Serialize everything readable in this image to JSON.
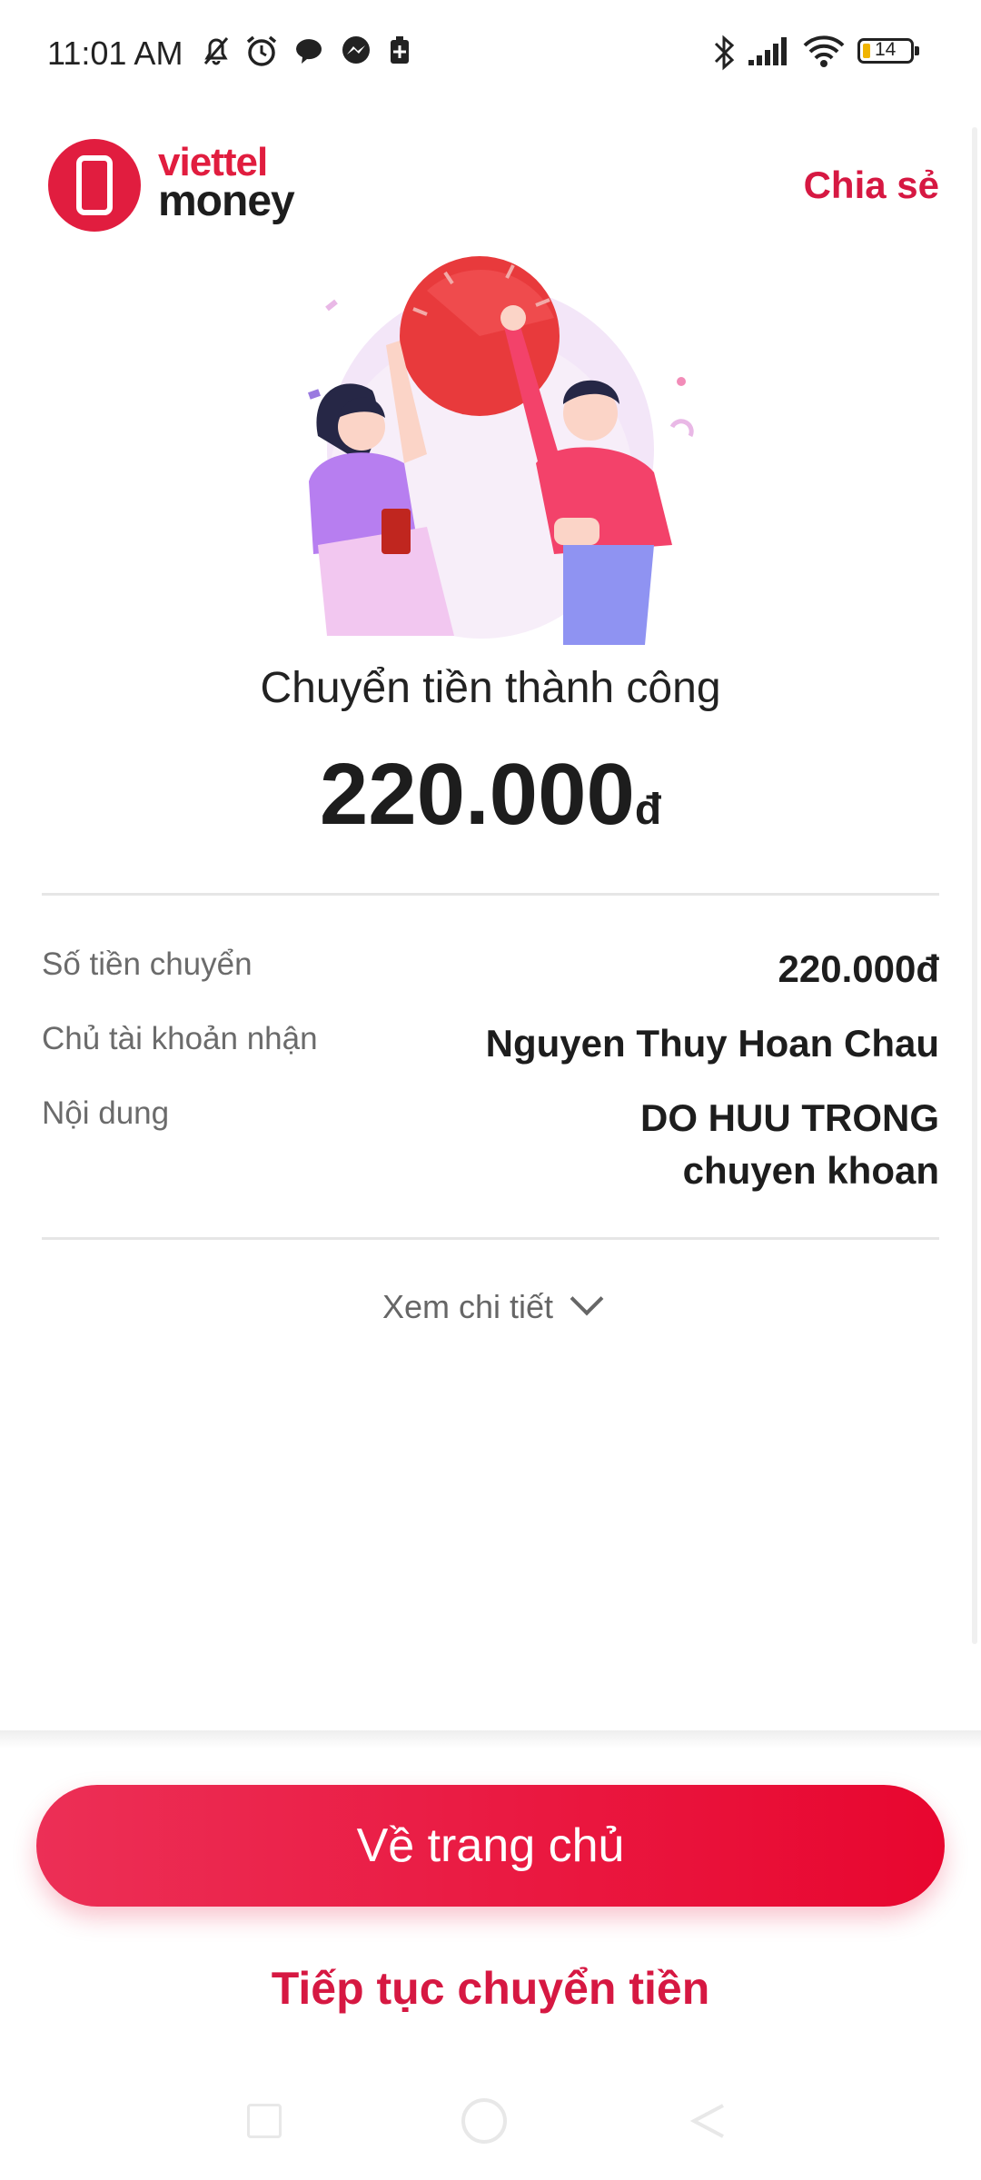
{
  "status_bar": {
    "time": "11:01 AM",
    "battery": "14",
    "icons": [
      "mute-bell-icon",
      "alarm-icon",
      "chat-icon",
      "messenger-icon",
      "battery-saver-icon",
      "bluetooth-icon",
      "signal-icon",
      "wifi-icon",
      "battery-icon"
    ]
  },
  "header": {
    "brand_line1": "viettel",
    "brand_line2": "money",
    "share": "Chia sẻ"
  },
  "result": {
    "title": "Chuyển tiền thành công",
    "amount": "220.000",
    "currency": "đ"
  },
  "details": [
    {
      "label": "Số tiền chuyển",
      "value": "220.000đ"
    },
    {
      "label": "Chủ tài khoản nhận",
      "value": "Nguyen Thuy Hoan Chau"
    },
    {
      "label": "Nội dung",
      "value": "DO HUU TRONG chuyen khoan"
    }
  ],
  "details_toggle": "Xem chi tiết",
  "actions": {
    "home": "Về trang chủ",
    "continue": "Tiếp tục chuyển tiền"
  },
  "colors": {
    "accent": "#e11d3f",
    "button_start": "#ec2f56",
    "button_end": "#e8062f"
  }
}
